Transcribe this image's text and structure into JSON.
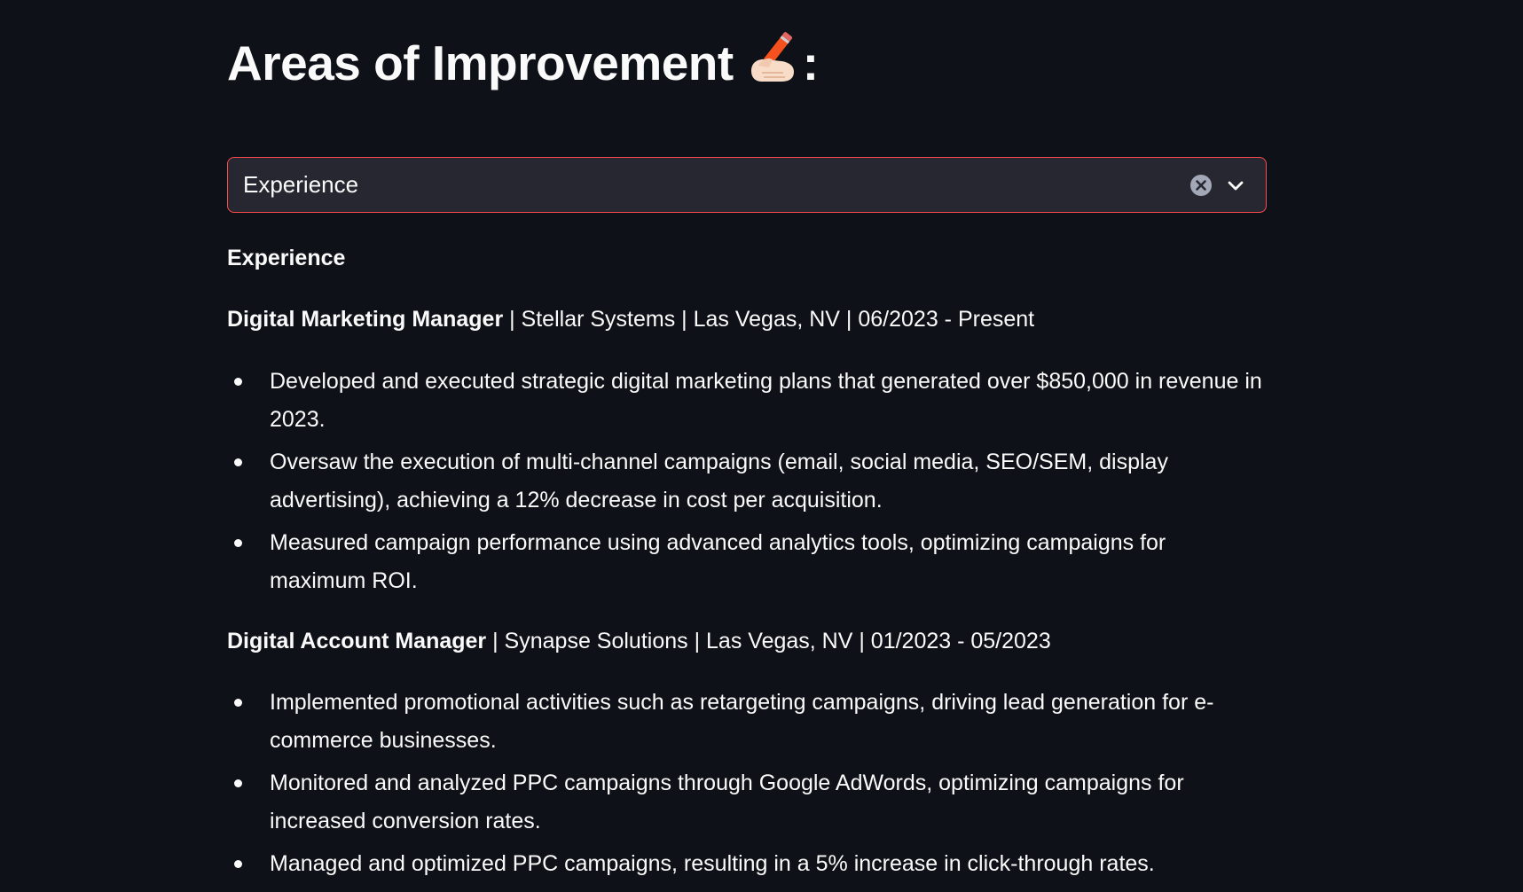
{
  "page": {
    "title": "Areas of Improvement",
    "title_suffix": ":",
    "title_emoji": "writing-hand-icon"
  },
  "select": {
    "value": "Experience",
    "border_color": "#ff4b4b"
  },
  "content": {
    "heading": "Experience",
    "jobs": [
      {
        "title": "Digital Marketing Manager",
        "details": " | Stellar Systems | Las Vegas, NV | 06/2023 - Present",
        "bullets": [
          "Developed and executed strategic digital marketing plans that generated over $850,000 in revenue in 2023.",
          "Oversaw the execution of multi-channel campaigns (email, social media, SEO/SEM, display advertising), achieving a 12% decrease in cost per acquisition.",
          "Measured campaign performance using advanced analytics tools, optimizing campaigns for maximum ROI."
        ]
      },
      {
        "title": "Digital Account Manager",
        "details": " | Synapse Solutions | Las Vegas, NV | 01/2023 - 05/2023",
        "bullets": [
          "Implemented promotional activities such as retargeting campaigns, driving lead generation for e-commerce businesses.",
          "Monitored and analyzed PPC campaigns through Google AdWords, optimizing campaigns for increased conversion rates.",
          "Managed and optimized PPC campaigns, resulting in a 5% increase in click-through rates."
        ]
      }
    ]
  },
  "colors": {
    "background": "#0e1117",
    "text": "#fafafa",
    "select_background": "#262730",
    "accent": "#ff4b4b"
  }
}
